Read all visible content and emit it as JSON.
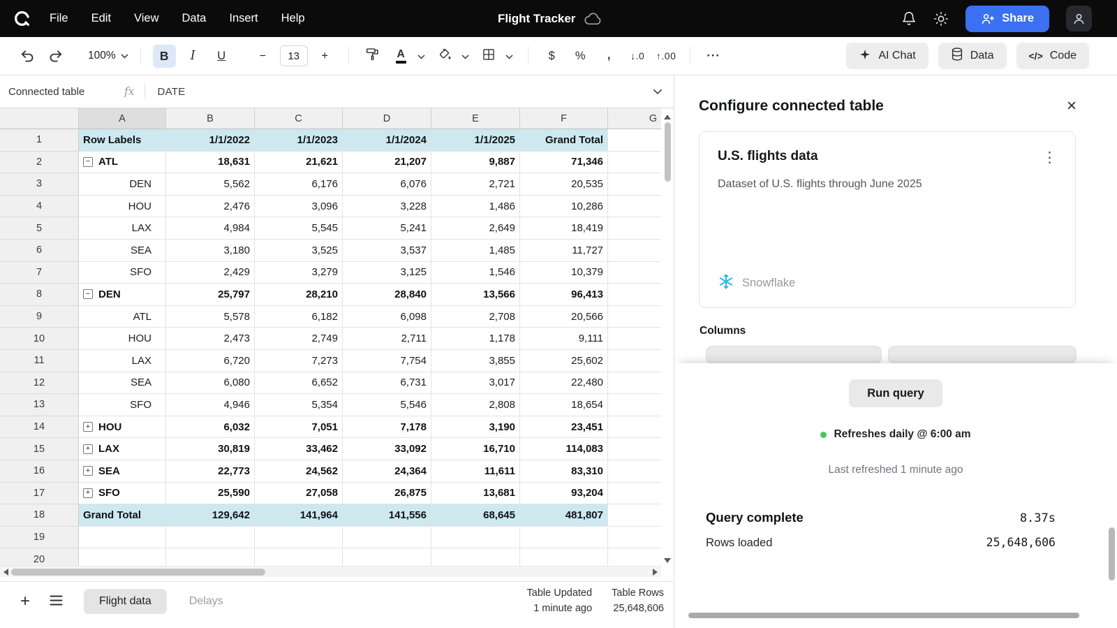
{
  "colors": {
    "accent_blue": "#3A70F1",
    "table_highlight": "#CDE8EF",
    "status_green": "#3FCA5F",
    "snowflake_blue": "#29B5E8"
  },
  "topbar": {
    "menus": [
      "File",
      "Edit",
      "View",
      "Data",
      "Insert",
      "Help"
    ],
    "title": "Flight Tracker",
    "share_label": "Share"
  },
  "toolbar": {
    "zoom_value": "100%",
    "font_size": "13",
    "glyphs": {
      "bold": "B",
      "italic": "I",
      "underline": "U",
      "decrease_font_size": "−",
      "increase_font_size": "+",
      "text_color": "A",
      "currency": "$",
      "percent": "%",
      "comma": ",",
      "decrease_decimals": "↓.0",
      "increase_decimals": "↑.00",
      "more": "···",
      "code": "</>"
    },
    "ai_chat_label": "AI Chat",
    "data_label": "Data",
    "code_label": "Code"
  },
  "formula_bar": {
    "name_box": "Connected table",
    "fx_label": "fx",
    "value": "DATE"
  },
  "grid": {
    "columns": [
      "A",
      "B",
      "C",
      "D",
      "E",
      "F",
      "G"
    ],
    "rows": [
      {
        "n": 1,
        "type": "header",
        "cells": [
          "Row Labels",
          "1/1/2022",
          "1/1/2023",
          "1/1/2024",
          "1/1/2025",
          "Grand Total"
        ]
      },
      {
        "n": 2,
        "type": "group",
        "toggle": "−",
        "label": "ATL",
        "values": [
          "18,631",
          "21,621",
          "21,207",
          "9,887",
          "71,346"
        ]
      },
      {
        "n": 3,
        "type": "child",
        "label": "DEN",
        "values": [
          "5,562",
          "6,176",
          "6,076",
          "2,721",
          "20,535"
        ]
      },
      {
        "n": 4,
        "type": "child",
        "label": "HOU",
        "values": [
          "2,476",
          "3,096",
          "3,228",
          "1,486",
          "10,286"
        ]
      },
      {
        "n": 5,
        "type": "child",
        "label": "LAX",
        "values": [
          "4,984",
          "5,545",
          "5,241",
          "2,649",
          "18,419"
        ]
      },
      {
        "n": 6,
        "type": "child",
        "label": "SEA",
        "values": [
          "3,180",
          "3,525",
          "3,537",
          "1,485",
          "11,727"
        ]
      },
      {
        "n": 7,
        "type": "child",
        "label": "SFO",
        "values": [
          "2,429",
          "3,279",
          "3,125",
          "1,546",
          "10,379"
        ]
      },
      {
        "n": 8,
        "type": "group",
        "toggle": "−",
        "label": "DEN",
        "values": [
          "25,797",
          "28,210",
          "28,840",
          "13,566",
          "96,413"
        ]
      },
      {
        "n": 9,
        "type": "child",
        "label": "ATL",
        "values": [
          "5,578",
          "6,182",
          "6,098",
          "2,708",
          "20,566"
        ]
      },
      {
        "n": 10,
        "type": "child",
        "label": "HOU",
        "values": [
          "2,473",
          "2,749",
          "2,711",
          "1,178",
          "9,111"
        ]
      },
      {
        "n": 11,
        "type": "child",
        "label": "LAX",
        "values": [
          "6,720",
          "7,273",
          "7,754",
          "3,855",
          "25,602"
        ]
      },
      {
        "n": 12,
        "type": "child",
        "label": "SEA",
        "values": [
          "6,080",
          "6,652",
          "6,731",
          "3,017",
          "22,480"
        ]
      },
      {
        "n": 13,
        "type": "child",
        "label": "SFO",
        "values": [
          "4,946",
          "5,354",
          "5,546",
          "2,808",
          "18,654"
        ]
      },
      {
        "n": 14,
        "type": "group",
        "toggle": "+",
        "label": "HOU",
        "values": [
          "6,032",
          "7,051",
          "7,178",
          "3,190",
          "23,451"
        ]
      },
      {
        "n": 15,
        "type": "group",
        "toggle": "+",
        "label": "LAX",
        "values": [
          "30,819",
          "33,462",
          "33,092",
          "16,710",
          "114,083"
        ]
      },
      {
        "n": 16,
        "type": "group",
        "toggle": "+",
        "label": "SEA",
        "values": [
          "22,773",
          "24,562",
          "24,364",
          "11,611",
          "83,310"
        ]
      },
      {
        "n": 17,
        "type": "group",
        "toggle": "+",
        "label": "SFO",
        "values": [
          "25,590",
          "27,058",
          "26,875",
          "13,681",
          "93,204"
        ]
      },
      {
        "n": 18,
        "type": "total",
        "label": "Grand Total",
        "values": [
          "129,642",
          "141,964",
          "141,556",
          "68,645",
          "481,807"
        ]
      },
      {
        "n": 19,
        "type": "empty"
      },
      {
        "n": 20,
        "type": "empty"
      }
    ]
  },
  "panel": {
    "title": "Configure connected table",
    "close_glyph": "×",
    "card": {
      "title": "U.S. flights data",
      "menu_glyph": "⋮",
      "description": "Dataset of U.S. flights through June 2025",
      "source": "Snowflake"
    },
    "columns_label": "Columns",
    "run_query_label": "Run query",
    "refresh_schedule": "Refreshes daily @ 6:00 am",
    "last_refreshed": "Last refreshed 1 minute ago",
    "query_complete_label": "Query complete",
    "query_time": "8.37s",
    "rows_loaded_label": "Rows loaded",
    "rows_loaded_value": "25,648,606"
  },
  "bottombar": {
    "add_glyph": "+",
    "tabs": [
      {
        "label": "Flight data",
        "active": true
      },
      {
        "label": "Delays",
        "active": false
      }
    ],
    "table_updated_label": "Table Updated",
    "table_updated_value": "1 minute ago",
    "table_rows_label": "Table Rows",
    "table_rows_value": "25,648,606"
  }
}
